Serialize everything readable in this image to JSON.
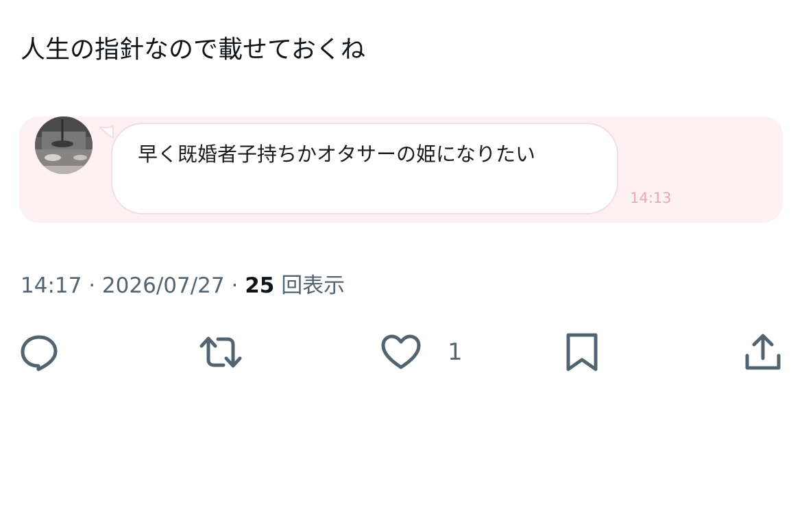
{
  "tweet": {
    "text": "人生の指針なので載せておくね"
  },
  "embedded_chat": {
    "message": "早く既婚者子持ちかオタサーの姫になりたい",
    "time": "14:13",
    "colors": {
      "card_background": "#fdf1f3",
      "bubble_border": "#f6dbe2",
      "time_text": "#e8a8b8"
    }
  },
  "meta": {
    "time": "14:17",
    "separator": "·",
    "date": "2026/07/27",
    "views_count": "25",
    "views_label": "回表示"
  },
  "actions": {
    "reply_icon": "reply-icon",
    "retweet_icon": "retweet-icon",
    "like_icon": "heart-icon",
    "like_count": "1",
    "bookmark_icon": "bookmark-icon",
    "share_icon": "share-icon",
    "icon_color": "#536471"
  }
}
